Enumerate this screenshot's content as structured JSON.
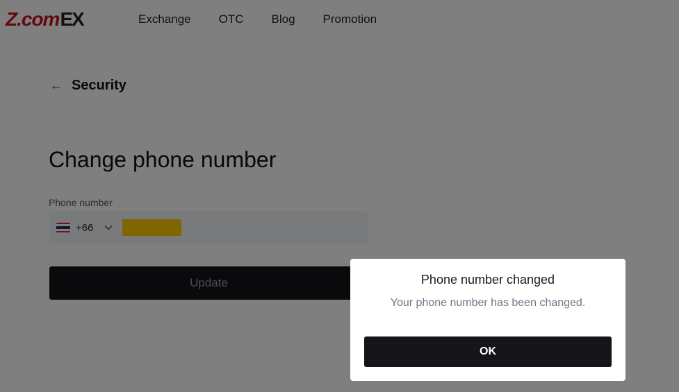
{
  "header": {
    "logo_main": "Z.com",
    "logo_suffix": "EX",
    "nav": [
      {
        "label": "Exchange"
      },
      {
        "label": "OTC"
      },
      {
        "label": "Blog"
      },
      {
        "label": "Promotion"
      }
    ]
  },
  "back": {
    "label": "Security",
    "arrow": "←"
  },
  "page_title": "Change phone number",
  "phone": {
    "label": "Phone number",
    "country_code": "+66",
    "country_flag": "thailand-flag-icon",
    "value": ""
  },
  "update_button": "Update",
  "modal": {
    "title": "Phone number changed",
    "message": "Your phone number has been changed.",
    "ok_label": "OK"
  },
  "colors": {
    "brand_red": "#c8121b",
    "button_dark": "#14141b",
    "redaction_yellow": "#ffcc00"
  }
}
